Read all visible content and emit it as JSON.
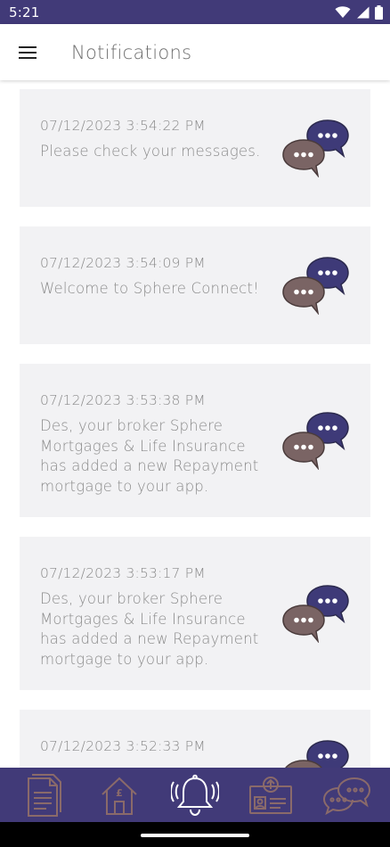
{
  "status_bar": {
    "time": "5:21"
  },
  "app_bar": {
    "title": "Notifications"
  },
  "notifications": [
    {
      "timestamp": "07/12/2023 3:54:22 PM",
      "message": "Please check your messages."
    },
    {
      "timestamp": "07/12/2023 3:54:09 PM",
      "message": "Welcome to Sphere Connect!"
    },
    {
      "timestamp": "07/12/2023 3:53:38 PM",
      "message": "Des, your broker Sphere Mortgages & Life Insurance has added a new Repayment mortgage to your app."
    },
    {
      "timestamp": "07/12/2023 3:53:17 PM",
      "message": "Des, your broker Sphere Mortgages & Life Insurance has added a new Repayment mortgage to your app."
    },
    {
      "timestamp": "07/12/2023 3:52:33 PM",
      "message": ""
    }
  ],
  "bottom_nav": {
    "items": [
      {
        "icon": "document-icon",
        "active": false
      },
      {
        "icon": "home-pound-icon",
        "active": false
      },
      {
        "icon": "bell-icon",
        "active": true
      },
      {
        "icon": "upload-id-icon",
        "active": false
      },
      {
        "icon": "chat-icon",
        "active": false
      }
    ]
  },
  "colors": {
    "brand_purple": "#413a78",
    "bubble_navy": "#3e3a78",
    "bubble_brown": "#7a6464",
    "nav_icon": "#8a6a6a",
    "nav_icon_active": "#ffffff",
    "card_bg": "#f2f2f4",
    "text_muted": "#8b8b8b"
  }
}
